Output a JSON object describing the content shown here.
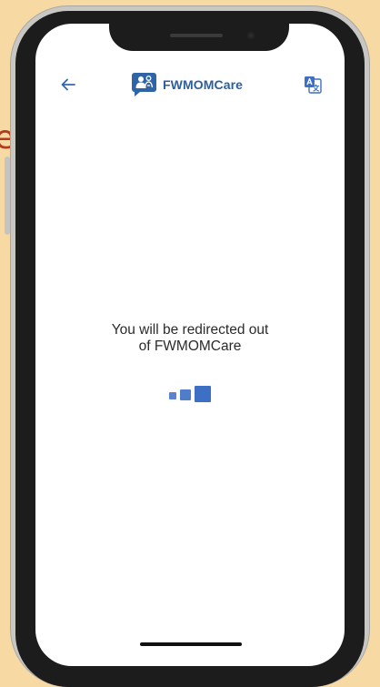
{
  "background": {
    "partial_glyph": "e"
  },
  "header": {
    "back_icon": "arrow-left-icon",
    "brand_name": "FWMOMCare",
    "logo_icon": "fwmomcare-logo-icon",
    "translate_icon": "translate-icon"
  },
  "message": {
    "line1": "You will be redirected out",
    "line2": "of FWMOMCare"
  },
  "loader": {
    "icon": "loading-squares-icon"
  },
  "colors": {
    "brand": "#2d5f9c",
    "accent": "#3d6fc4",
    "page_background": "#f7d9a3",
    "background_glyph": "#b33a1f"
  }
}
